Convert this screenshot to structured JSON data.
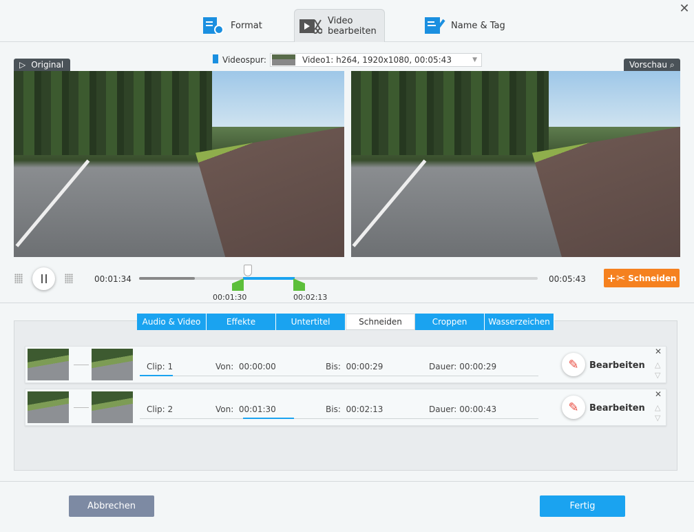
{
  "tabs": [
    {
      "label": "Format",
      "icon": "format-settings-icon"
    },
    {
      "label": "Video bearbeiten",
      "icon": "video-edit-icon"
    },
    {
      "label": "Name & Tag",
      "icon": "name-tag-icon"
    }
  ],
  "videospur": {
    "label": "Videospur:",
    "value": "Video1: h264, 1920x1080, 00:05:43"
  },
  "preview": {
    "original_label": "Original",
    "preview_label": "Vorschau"
  },
  "player": {
    "current_time": "00:01:34",
    "total_time": "00:05:43",
    "marker_start": "00:01:30",
    "marker_end": "00:02:13",
    "cut_button": "Schneiden",
    "progress_fraction": 0.14
  },
  "edit_tabs": [
    "Audio & Video",
    "Effekte",
    "Untertitel",
    "Schneiden",
    "Croppen",
    "Wasserzeichen"
  ],
  "clips": [
    {
      "clip_label": "Clip:",
      "clip": "1",
      "von_label": "Von:",
      "von": "00:00:00",
      "bis_label": "Bis:",
      "bis": "00:00:29",
      "dauer_label": "Dauer:",
      "dauer": "00:00:29",
      "edit": "Bearbeiten"
    },
    {
      "clip_label": "Clip:",
      "clip": "2",
      "von_label": "Von:",
      "von": "00:01:30",
      "bis_label": "Bis:",
      "bis": "00:02:13",
      "dauer_label": "Dauer:",
      "dauer": "00:00:43",
      "edit": "Bearbeiten"
    }
  ],
  "footer": {
    "cancel": "Abbrechen",
    "done": "Fertig"
  },
  "colors": {
    "accent": "#1aa3f0",
    "orange": "#f5811f",
    "marker": "#5cbf3a"
  }
}
